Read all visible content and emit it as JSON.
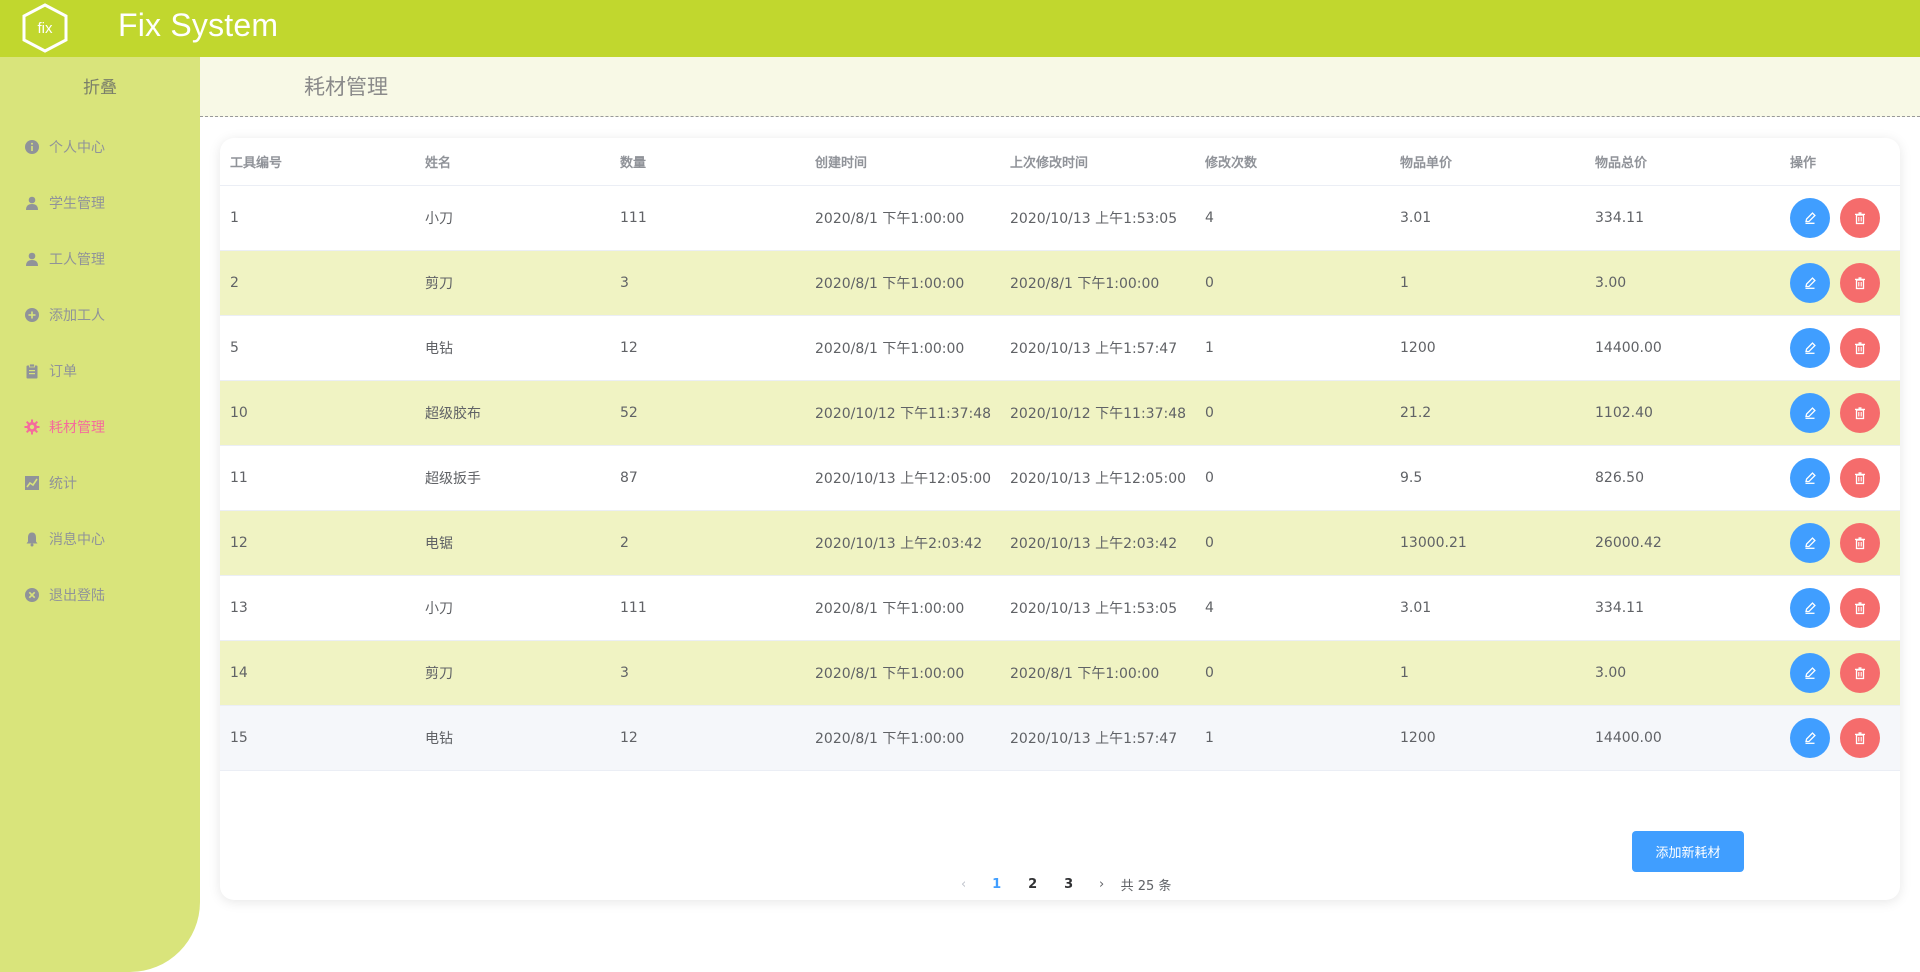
{
  "app": {
    "title": "Fix System",
    "logo_text": "fix",
    "brand_color": "#c1d72e"
  },
  "sidebar": {
    "collapse_label": "折叠",
    "items": [
      {
        "label": "个人中心",
        "icon": "info-icon",
        "active": false
      },
      {
        "label": "学生管理",
        "icon": "user-icon",
        "active": false
      },
      {
        "label": "工人管理",
        "icon": "user-icon",
        "active": false
      },
      {
        "label": "添加工人",
        "icon": "plus-circle-icon",
        "active": false
      },
      {
        "label": "订单",
        "icon": "clipboard-icon",
        "active": false
      },
      {
        "label": "耗材管理",
        "icon": "gear-icon",
        "active": true
      },
      {
        "label": "统计",
        "icon": "chart-icon",
        "active": false
      },
      {
        "label": "消息中心",
        "icon": "bell-icon",
        "active": false
      },
      {
        "label": "退出登陆",
        "icon": "close-circle-icon",
        "active": false
      }
    ]
  },
  "page": {
    "title": "耗材管理"
  },
  "table": {
    "headers": [
      "工具编号",
      "姓名",
      "数量",
      "创建时间",
      "上次修改时间",
      "修改次数",
      "物品单价",
      "物品总价",
      "操作"
    ],
    "rows": [
      [
        "1",
        "小刀",
        "111",
        "2020/8/1 下午1:00:00",
        "2020/10/13 上午1:53:05",
        "4",
        "3.01",
        "334.11"
      ],
      [
        "2",
        "剪刀",
        "3",
        "2020/8/1 下午1:00:00",
        "2020/8/1 下午1:00:00",
        "0",
        "1",
        "3.00"
      ],
      [
        "5",
        "电钻",
        "12",
        "2020/8/1 下午1:00:00",
        "2020/10/13 上午1:57:47",
        "1",
        "1200",
        "14400.00"
      ],
      [
        "10",
        "超级胶布",
        "52",
        "2020/10/12 下午11:37:48",
        "2020/10/12 下午11:37:48",
        "0",
        "21.2",
        "1102.40"
      ],
      [
        "11",
        "超级扳手",
        "87",
        "2020/10/13 上午12:05:00",
        "2020/10/13 上午12:05:00",
        "0",
        "9.5",
        "826.50"
      ],
      [
        "12",
        "电锯",
        "2",
        "2020/10/13 上午2:03:42",
        "2020/10/13 上午2:03:42",
        "0",
        "13000.21",
        "26000.42"
      ],
      [
        "13",
        "小刀",
        "111",
        "2020/8/1 下午1:00:00",
        "2020/10/13 上午1:53:05",
        "4",
        "3.01",
        "334.11"
      ],
      [
        "14",
        "剪刀",
        "3",
        "2020/8/1 下午1:00:00",
        "2020/8/1 下午1:00:00",
        "0",
        "1",
        "3.00"
      ],
      [
        "15",
        "电钻",
        "12",
        "2020/8/1 下午1:00:00",
        "2020/10/13 上午1:57:47",
        "1",
        "1200",
        "14400.00"
      ]
    ]
  },
  "actions": {
    "add_label": "添加新耗材"
  },
  "pagination": {
    "pages": [
      "1",
      "2",
      "3"
    ],
    "current": "1",
    "total_text": "共 25 条"
  },
  "colors": {
    "edit": "#409eff",
    "delete": "#f56c6c",
    "stripe": "#f0f3c3",
    "sidebar": "#d9e47b"
  }
}
